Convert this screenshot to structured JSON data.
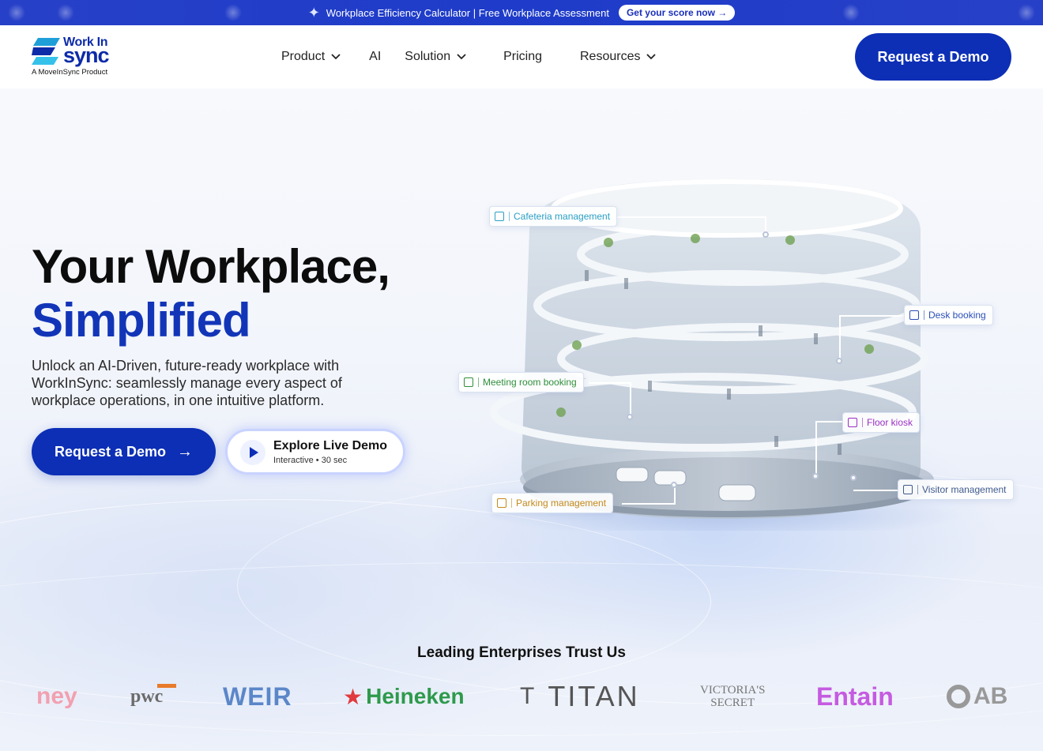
{
  "announcement": {
    "text": "Workplace Efficiency Calculator | Free Workplace Assessment",
    "cta": "Get your score now →",
    "icon": "sparkle-icon"
  },
  "header": {
    "logo_top": "Work In",
    "logo_bottom": "sync",
    "logo_tagline": "A MoveInSync Product",
    "nav": [
      {
        "label": "Product",
        "dropdown": true
      },
      {
        "label": "AI",
        "dropdown": false
      },
      {
        "label": "Solution",
        "dropdown": true
      },
      {
        "label": "Pricing",
        "dropdown": false
      },
      {
        "label": "Resources",
        "dropdown": true
      }
    ],
    "demo_button": "Request a Demo"
  },
  "hero": {
    "title_line1": "Your Workplace,",
    "title_line2": "Simplified",
    "subtitle": "Unlock an AI-Driven, future-ready workplace with WorkInSync: seamlessly manage every aspect of workplace operations, in one intuitive platform.",
    "primary_cta": "Request a Demo",
    "secondary_cta_title": "Explore Live Demo",
    "secondary_cta_sub": "Interactive • 30 sec"
  },
  "features": {
    "cafeteria": "Cafeteria management",
    "desk": "Desk booking",
    "meeting": "Meeting room booking",
    "kiosk": "Floor kiosk",
    "visitor": "Visitor management",
    "parking": "Parking management"
  },
  "colors": {
    "brand": "#0c2fb5",
    "cafeteria": "#2a9fc4",
    "desk": "#2b4fb8",
    "meeting": "#2f8f3a",
    "kiosk": "#9a2fc4",
    "visitor": "#3f5a8c",
    "parking": "#c48a1a"
  },
  "trust": {
    "title": "Leading Enterprises Trust Us",
    "logos": [
      "ney",
      "pwc",
      "WEIR",
      "Heineken",
      "TITAN",
      "VICTORIA'S",
      "SECRET",
      "Entain",
      "AB"
    ]
  }
}
